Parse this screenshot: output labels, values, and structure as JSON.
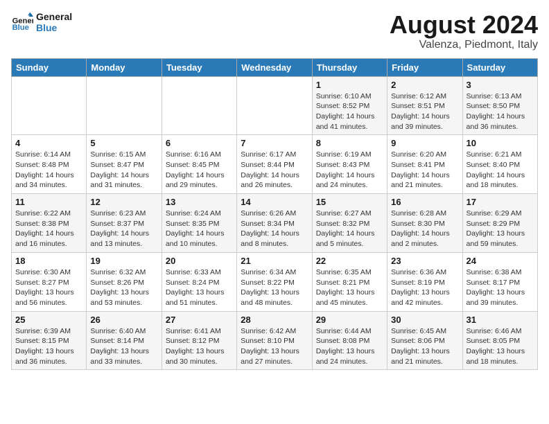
{
  "logo": {
    "text_general": "General",
    "text_blue": "Blue"
  },
  "title": "August 2024",
  "subtitle": "Valenza, Piedmont, Italy",
  "weekdays": [
    "Sunday",
    "Monday",
    "Tuesday",
    "Wednesday",
    "Thursday",
    "Friday",
    "Saturday"
  ],
  "weeks": [
    [
      {
        "day": "",
        "info": ""
      },
      {
        "day": "",
        "info": ""
      },
      {
        "day": "",
        "info": ""
      },
      {
        "day": "",
        "info": ""
      },
      {
        "day": "1",
        "info": "Sunrise: 6:10 AM\nSunset: 8:52 PM\nDaylight: 14 hours\nand 41 minutes."
      },
      {
        "day": "2",
        "info": "Sunrise: 6:12 AM\nSunset: 8:51 PM\nDaylight: 14 hours\nand 39 minutes."
      },
      {
        "day": "3",
        "info": "Sunrise: 6:13 AM\nSunset: 8:50 PM\nDaylight: 14 hours\nand 36 minutes."
      }
    ],
    [
      {
        "day": "4",
        "info": "Sunrise: 6:14 AM\nSunset: 8:48 PM\nDaylight: 14 hours\nand 34 minutes."
      },
      {
        "day": "5",
        "info": "Sunrise: 6:15 AM\nSunset: 8:47 PM\nDaylight: 14 hours\nand 31 minutes."
      },
      {
        "day": "6",
        "info": "Sunrise: 6:16 AM\nSunset: 8:45 PM\nDaylight: 14 hours\nand 29 minutes."
      },
      {
        "day": "7",
        "info": "Sunrise: 6:17 AM\nSunset: 8:44 PM\nDaylight: 14 hours\nand 26 minutes."
      },
      {
        "day": "8",
        "info": "Sunrise: 6:19 AM\nSunset: 8:43 PM\nDaylight: 14 hours\nand 24 minutes."
      },
      {
        "day": "9",
        "info": "Sunrise: 6:20 AM\nSunset: 8:41 PM\nDaylight: 14 hours\nand 21 minutes."
      },
      {
        "day": "10",
        "info": "Sunrise: 6:21 AM\nSunset: 8:40 PM\nDaylight: 14 hours\nand 18 minutes."
      }
    ],
    [
      {
        "day": "11",
        "info": "Sunrise: 6:22 AM\nSunset: 8:38 PM\nDaylight: 14 hours\nand 16 minutes."
      },
      {
        "day": "12",
        "info": "Sunrise: 6:23 AM\nSunset: 8:37 PM\nDaylight: 14 hours\nand 13 minutes."
      },
      {
        "day": "13",
        "info": "Sunrise: 6:24 AM\nSunset: 8:35 PM\nDaylight: 14 hours\nand 10 minutes."
      },
      {
        "day": "14",
        "info": "Sunrise: 6:26 AM\nSunset: 8:34 PM\nDaylight: 14 hours\nand 8 minutes."
      },
      {
        "day": "15",
        "info": "Sunrise: 6:27 AM\nSunset: 8:32 PM\nDaylight: 14 hours\nand 5 minutes."
      },
      {
        "day": "16",
        "info": "Sunrise: 6:28 AM\nSunset: 8:30 PM\nDaylight: 14 hours\nand 2 minutes."
      },
      {
        "day": "17",
        "info": "Sunrise: 6:29 AM\nSunset: 8:29 PM\nDaylight: 13 hours\nand 59 minutes."
      }
    ],
    [
      {
        "day": "18",
        "info": "Sunrise: 6:30 AM\nSunset: 8:27 PM\nDaylight: 13 hours\nand 56 minutes."
      },
      {
        "day": "19",
        "info": "Sunrise: 6:32 AM\nSunset: 8:26 PM\nDaylight: 13 hours\nand 53 minutes."
      },
      {
        "day": "20",
        "info": "Sunrise: 6:33 AM\nSunset: 8:24 PM\nDaylight: 13 hours\nand 51 minutes."
      },
      {
        "day": "21",
        "info": "Sunrise: 6:34 AM\nSunset: 8:22 PM\nDaylight: 13 hours\nand 48 minutes."
      },
      {
        "day": "22",
        "info": "Sunrise: 6:35 AM\nSunset: 8:21 PM\nDaylight: 13 hours\nand 45 minutes."
      },
      {
        "day": "23",
        "info": "Sunrise: 6:36 AM\nSunset: 8:19 PM\nDaylight: 13 hours\nand 42 minutes."
      },
      {
        "day": "24",
        "info": "Sunrise: 6:38 AM\nSunset: 8:17 PM\nDaylight: 13 hours\nand 39 minutes."
      }
    ],
    [
      {
        "day": "25",
        "info": "Sunrise: 6:39 AM\nSunset: 8:15 PM\nDaylight: 13 hours\nand 36 minutes."
      },
      {
        "day": "26",
        "info": "Sunrise: 6:40 AM\nSunset: 8:14 PM\nDaylight: 13 hours\nand 33 minutes."
      },
      {
        "day": "27",
        "info": "Sunrise: 6:41 AM\nSunset: 8:12 PM\nDaylight: 13 hours\nand 30 minutes."
      },
      {
        "day": "28",
        "info": "Sunrise: 6:42 AM\nSunset: 8:10 PM\nDaylight: 13 hours\nand 27 minutes."
      },
      {
        "day": "29",
        "info": "Sunrise: 6:44 AM\nSunset: 8:08 PM\nDaylight: 13 hours\nand 24 minutes."
      },
      {
        "day": "30",
        "info": "Sunrise: 6:45 AM\nSunset: 8:06 PM\nDaylight: 13 hours\nand 21 minutes."
      },
      {
        "day": "31",
        "info": "Sunrise: 6:46 AM\nSunset: 8:05 PM\nDaylight: 13 hours\nand 18 minutes."
      }
    ]
  ]
}
